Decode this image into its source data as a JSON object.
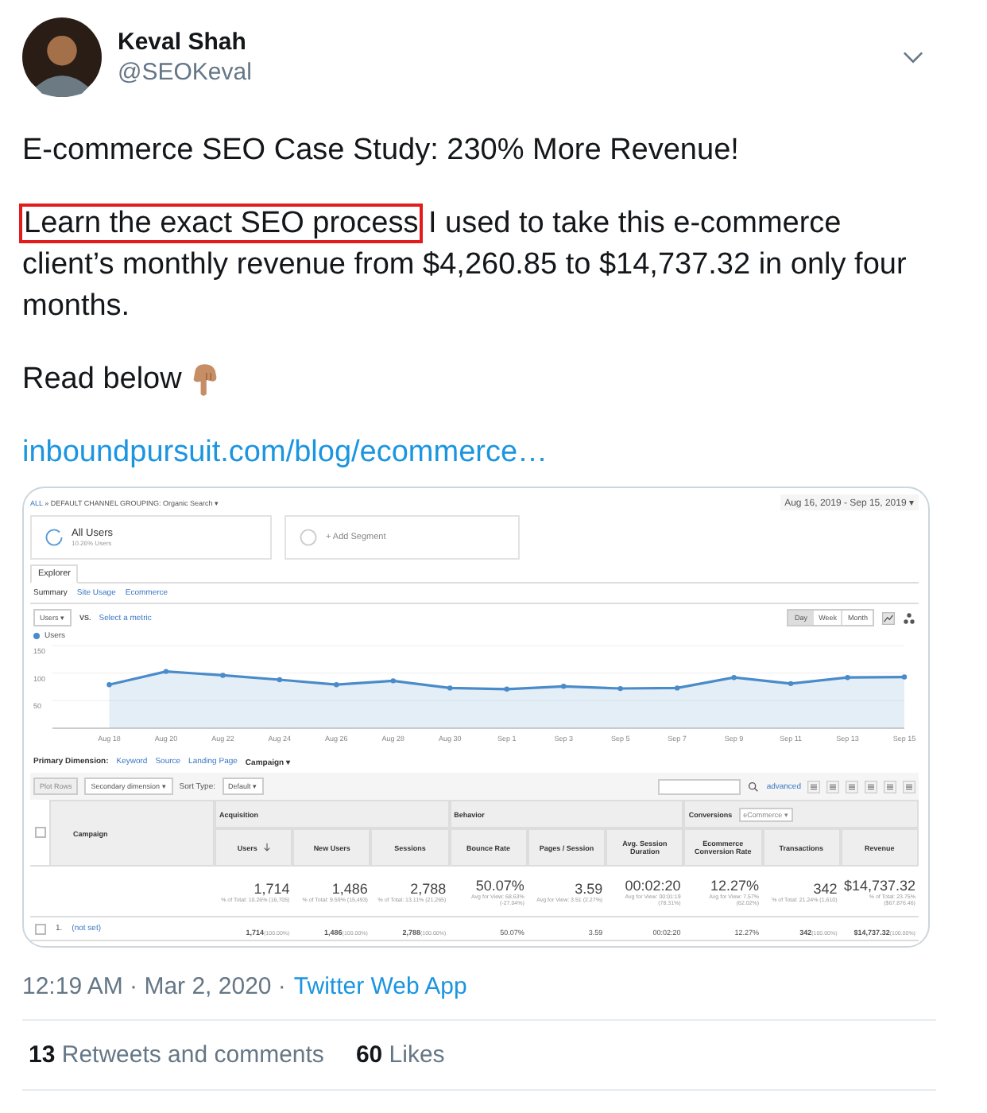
{
  "tweet": {
    "author": {
      "name": "Keval Shah",
      "handle": "@SEOKeval"
    },
    "title": "E-commerce SEO Case Study: 230% More Revenue!",
    "body": [
      {
        "text": "Learn the exact SEO process",
        "boxed": true
      },
      {
        "text": " I used to take this e-commerce client’s monthly revenue from $4,260.85 to $14,737.32 in only four months.",
        "boxed": false
      }
    ],
    "read_below": "Read below",
    "link": "inboundpursuit.com/blog/ecommerce…",
    "timestamp": "12:19 AM · Mar 2, 2020 ·",
    "source": "Twitter Web App",
    "stats": [
      {
        "count": "13",
        "label": "Retweets and comments"
      },
      {
        "count": "60",
        "label": "Likes"
      }
    ]
  },
  "analytics": {
    "breadcrumb": {
      "root": "ALL",
      "rest": "» DEFAULT CHANNEL GROUPING: Organic Search ▾"
    },
    "date_range": "Aug 16, 2019 - Sep 15, 2019 ▾",
    "segments": [
      {
        "kind": "active",
        "name": "All Users",
        "detail": "10.26% Users"
      },
      {
        "kind": "add",
        "name": "+ Add Segment"
      }
    ],
    "tabs": [
      {
        "label": "Explorer",
        "selected": true
      }
    ],
    "subtabs": [
      {
        "label": "Summary",
        "selected": true
      },
      {
        "label": "Site Usage",
        "selected": false
      },
      {
        "label": "Ecommerce",
        "selected": false
      }
    ],
    "metric": {
      "value": "Users ▾",
      "vs": "VS.",
      "other": "Select a metric"
    },
    "periods": [
      {
        "label": "Day",
        "selected": true
      },
      {
        "label": "Week",
        "selected": false
      },
      {
        "label": "Month",
        "selected": false
      }
    ],
    "chart_data": {
      "type": "area",
      "ylim": [
        0,
        150
      ],
      "yticks": [
        50,
        100,
        150
      ],
      "categories": [
        "Aug 18",
        "Aug 20",
        "Aug 22",
        "Aug 24",
        "Aug 26",
        "Aug 28",
        "Aug 30",
        "Sep 1",
        "Sep 3",
        "Sep 5",
        "Sep 7",
        "Sep 9",
        "Sep 11",
        "Sep 13",
        "Sep 15"
      ],
      "series": [
        {
          "name": "Users",
          "color": "#4a8bc9",
          "values": [
            79,
            103,
            96,
            88,
            79,
            86,
            73,
            71,
            76,
            72,
            73,
            92,
            81,
            92,
            93
          ]
        }
      ]
    },
    "primary_dimension": {
      "label": "Primary Dimension:",
      "options": [
        {
          "label": "Keyword",
          "selected": false
        },
        {
          "label": "Source",
          "selected": false
        },
        {
          "label": "Landing Page",
          "selected": false
        },
        {
          "label": "Campaign ▾",
          "selected": true
        }
      ]
    },
    "toolbar": {
      "plot_rows": "Plot Rows",
      "secondary": "Secondary dimension ▾",
      "sort_label": "Sort Type:",
      "sort_value": "Default ▾",
      "advanced": "advanced"
    },
    "table": {
      "first_column": "Campaign",
      "header_checked": false,
      "groups": [
        {
          "label": "Acquisition",
          "columns": [
            {
              "label": "Users",
              "sorted": true
            },
            {
              "label": "New Users",
              "sorted": false
            },
            {
              "label": "Sessions",
              "sorted": false
            }
          ]
        },
        {
          "label": "Behavior",
          "columns": [
            {
              "label": "Bounce Rate",
              "sorted": false
            },
            {
              "label": "Pages / Session",
              "sorted": false
            },
            {
              "label": "Avg. Session Duration",
              "sorted": false
            }
          ]
        },
        {
          "label": "Conversions",
          "dropdown": "eCommerce ▾",
          "columns": [
            {
              "label": "Ecommerce Conversion Rate",
              "sorted": false
            },
            {
              "label": "Transactions",
              "sorted": false
            },
            {
              "label": "Revenue",
              "sorted": false
            }
          ]
        }
      ],
      "totals": [
        {
          "value": "1,714",
          "note": "% of Total: 10.26% (16,705)"
        },
        {
          "value": "1,486",
          "note": "% of Total: 9.59% (15,493)"
        },
        {
          "value": "2,788",
          "note": "% of Total: 13.11% (21,265)"
        },
        {
          "value": "50.07%",
          "note": "Avg for View: 68.63% (-27.04%)"
        },
        {
          "value": "3.59",
          "note": "Avg for View: 3.51 (2.27%)"
        },
        {
          "value": "00:02:20",
          "note": "Avg for View: 00:01:19 (78.31%)"
        },
        {
          "value": "12.27%",
          "note": "Avg for View: 7.57% (62.02%)"
        },
        {
          "value": "342",
          "note": "% of Total: 21.24% (1,610)"
        },
        {
          "value": "$14,737.32",
          "note": "% of Total: 23.75% ($67,876.46)"
        }
      ],
      "rows": [
        {
          "checked": false,
          "index": "1.",
          "name": "(not set)",
          "cells": [
            {
              "value": "1,714",
              "share": "(100.00%)"
            },
            {
              "value": "1,486",
              "share": "(100.00%)"
            },
            {
              "value": "2,788",
              "share": "(100.00%)"
            },
            {
              "value": "50.07%"
            },
            {
              "value": "3.59"
            },
            {
              "value": "00:02:20"
            },
            {
              "value": "12.27%"
            },
            {
              "value": "342",
              "share": "(100.00%)"
            },
            {
              "value": "$14,737.32",
              "share": "(100.00%)"
            }
          ]
        }
      ]
    }
  }
}
